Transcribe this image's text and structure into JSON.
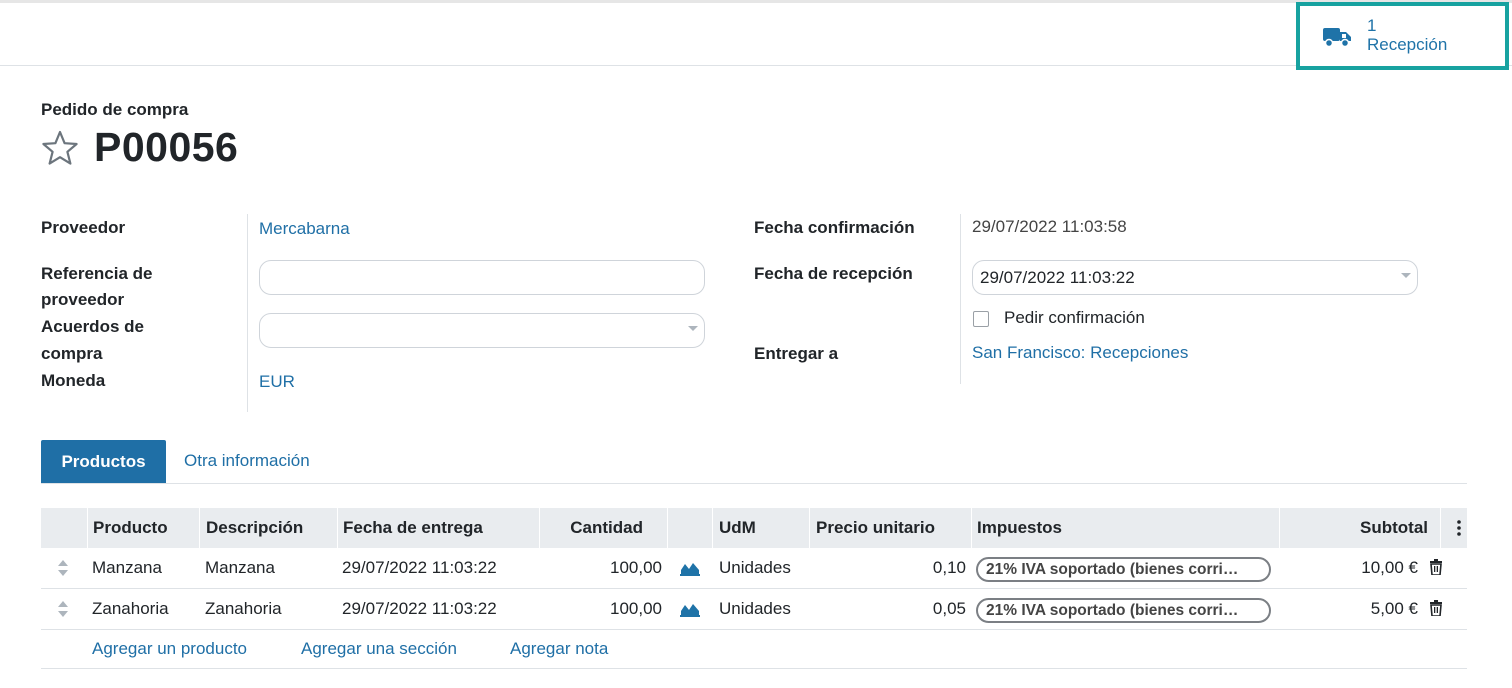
{
  "smart_button": {
    "count": "1",
    "label": "Recepción",
    "icon": "truck-icon"
  },
  "header": {
    "subtitle": "Pedido de compra",
    "title": "P00056",
    "star_icon": "star-outline-icon"
  },
  "fields_left": {
    "vendor_label": "Proveedor",
    "vendor_value": "Mercabarna",
    "vendor_ref_label_1": "Referencia de",
    "vendor_ref_label_2": "proveedor",
    "vendor_ref_value": "",
    "agreements_label_1": "Acuerdos de",
    "agreements_label_2": "compra",
    "agreements_value": "",
    "currency_label": "Moneda",
    "currency_value": "EUR"
  },
  "fields_right": {
    "confirm_date_label": "Fecha confirmación",
    "confirm_date_value": "29/07/2022 11:03:58",
    "receipt_date_label": "Fecha de recepción",
    "receipt_date_value": "29/07/2022 11:03:22",
    "ask_confirmation_label": "Pedir confirmación",
    "deliver_to_label": "Entregar a",
    "deliver_to_value": "San Francisco: Recepciones"
  },
  "tabs": {
    "active": "Productos",
    "other": "Otra información"
  },
  "table": {
    "headers": {
      "product": "Producto",
      "description": "Descripción",
      "delivery_date": "Fecha de entrega",
      "quantity": "Cantidad",
      "uom": "UdM",
      "unit_price": "Precio unitario",
      "taxes": "Impuestos",
      "subtotal": "Subtotal"
    },
    "rows": [
      {
        "product": "Manzana",
        "description": "Manzana",
        "delivery_date": "29/07/2022 11:03:22",
        "quantity": "100,00",
        "uom": "Unidades",
        "unit_price": "0,10",
        "tax": "21% IVA soportado (bienes corri…",
        "subtotal": "10,00 €"
      },
      {
        "product": "Zanahoria",
        "description": "Zanahoria",
        "delivery_date": "29/07/2022 11:03:22",
        "quantity": "100,00",
        "uom": "Unidades",
        "unit_price": "0,05",
        "tax": "21% IVA soportado (bienes corri…",
        "subtotal": "5,00 €"
      }
    ],
    "add_product": "Agregar un producto",
    "add_section": "Agregar una sección",
    "add_note": "Agregar nota"
  },
  "colors": {
    "accent": "#1f6fa6",
    "highlight": "#17a2a0"
  }
}
